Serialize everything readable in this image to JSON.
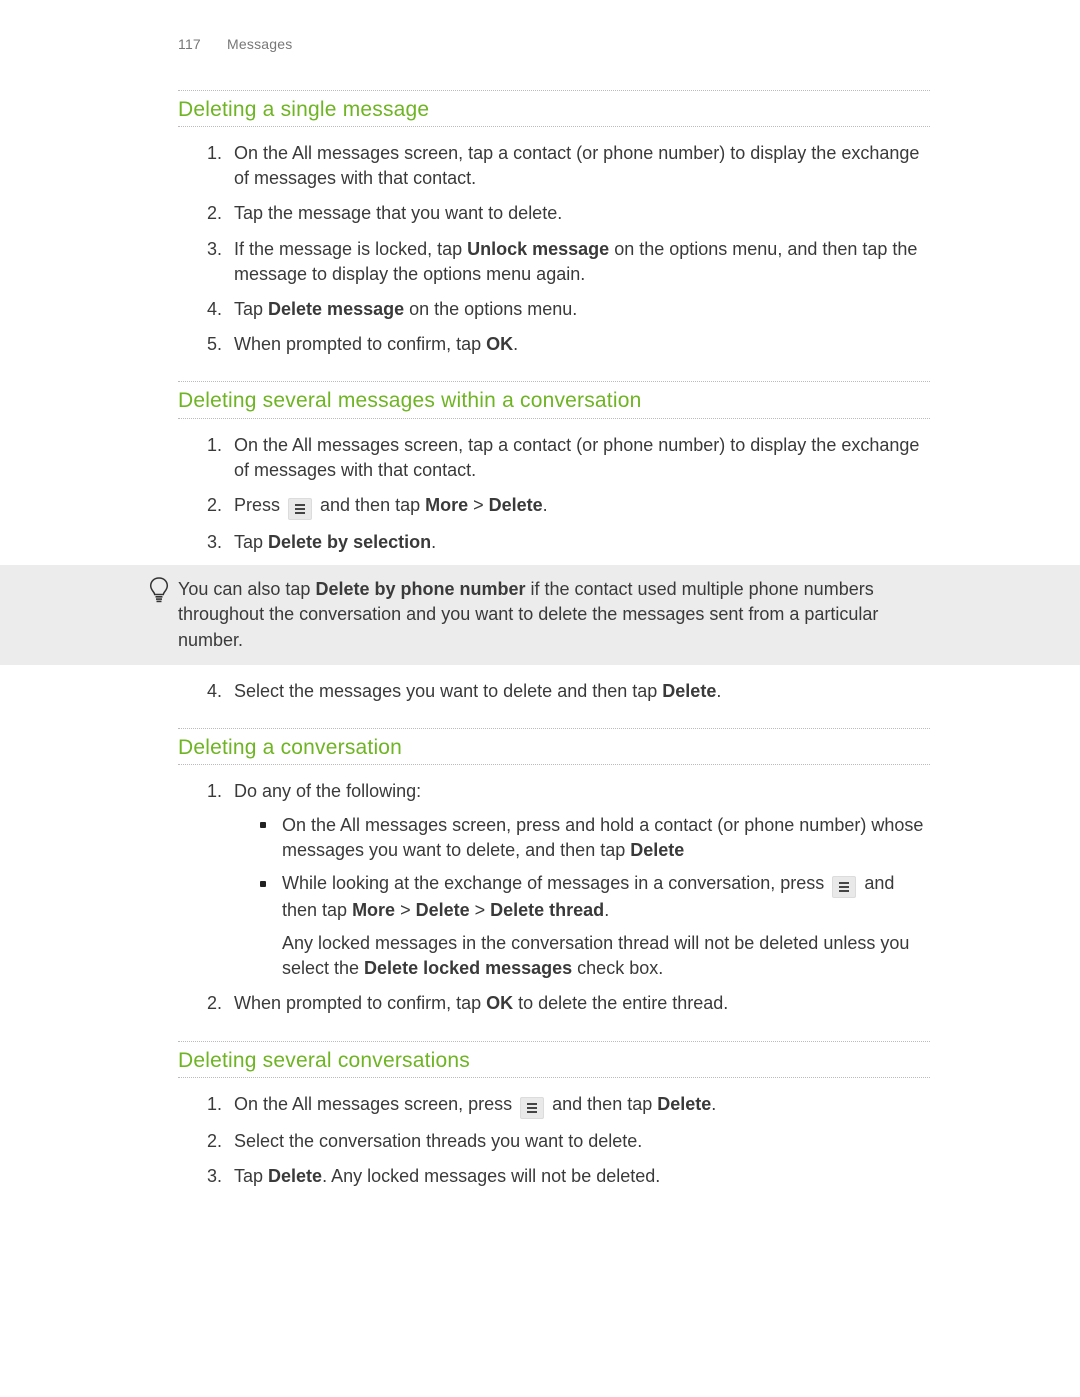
{
  "header": {
    "page_number": "117",
    "chapter": "Messages"
  },
  "sections": [
    {
      "title": "Deleting a single message",
      "steps": [
        {
          "n": "1.",
          "text": "On the All messages screen, tap a contact (or phone number) to display the exchange of messages with that contact."
        },
        {
          "n": "2.",
          "text": "Tap the message that you want to delete."
        },
        {
          "n": "3.",
          "text_before": "If the message is locked, tap ",
          "bold_1": "Unlock message",
          "text_after": " on the options menu, and then tap the message to display the options menu again."
        },
        {
          "n": "4.",
          "text_before": "Tap ",
          "bold_1": "Delete message",
          "text_after": " on the options menu."
        },
        {
          "n": "5.",
          "text_before": "When prompted to confirm, tap ",
          "bold_1": "OK",
          "text_after": "."
        }
      ]
    },
    {
      "title": "Deleting several messages within a conversation",
      "steps_a": [
        {
          "n": "1.",
          "text": "On the All messages screen, tap a contact (or phone number) to display the exchange of messages with that contact."
        },
        {
          "n": "2.",
          "text_before": "Press ",
          "icon": "menu",
          "text_mid": " and then tap ",
          "bold_1": "More",
          "sep": " > ",
          "bold_2": "Delete",
          "text_after": "."
        },
        {
          "n": "3.",
          "text_before": "Tap ",
          "bold_1": "Delete by selection",
          "text_after": "."
        }
      ],
      "tip": {
        "text_before": "You can also tap ",
        "bold_1": "Delete by phone number",
        "text_after": " if the contact used multiple phone numbers throughout the conversation and you want to delete the messages sent from a particular number."
      },
      "steps_b": [
        {
          "n": "4.",
          "text_before": "Select the messages you want to delete and then tap ",
          "bold_1": "Delete",
          "text_after": "."
        }
      ]
    },
    {
      "title": "Deleting a conversation",
      "steps": [
        {
          "n": "1.",
          "text": "Do any of the following:",
          "bullets": [
            {
              "text_before": "On the All messages screen, press and hold a contact (or phone number) whose messages you want to delete, and then tap ",
              "bold_1": "Delete"
            },
            {
              "text_before": "While looking at the exchange of messages in a conversation, press ",
              "icon": "menu",
              "text_mid": " and then tap ",
              "bold_1": "More",
              "sep1": " > ",
              "bold_2": "Delete",
              "sep2": " > ",
              "bold_3": "Delete thread",
              "text_after": "."
            }
          ],
          "sub_before": "Any locked messages in the conversation thread will not be deleted unless you select the ",
          "sub_bold": "Delete locked messages",
          "sub_after": " check box."
        },
        {
          "n": "2.",
          "text_before": "When prompted to confirm, tap ",
          "bold_1": "OK",
          "text_after": " to delete the entire thread."
        }
      ]
    },
    {
      "title": "Deleting several conversations",
      "steps": [
        {
          "n": "1.",
          "text_before": "On the All messages screen, press ",
          "icon": "menu",
          "text_mid": " and then tap ",
          "bold_1": "Delete",
          "text_after": "."
        },
        {
          "n": "2.",
          "text": "Select the conversation threads you want to delete."
        },
        {
          "n": "3.",
          "text_before": "Tap ",
          "bold_1": "Delete",
          "text_after": ". Any locked messages will not be deleted."
        }
      ]
    }
  ]
}
